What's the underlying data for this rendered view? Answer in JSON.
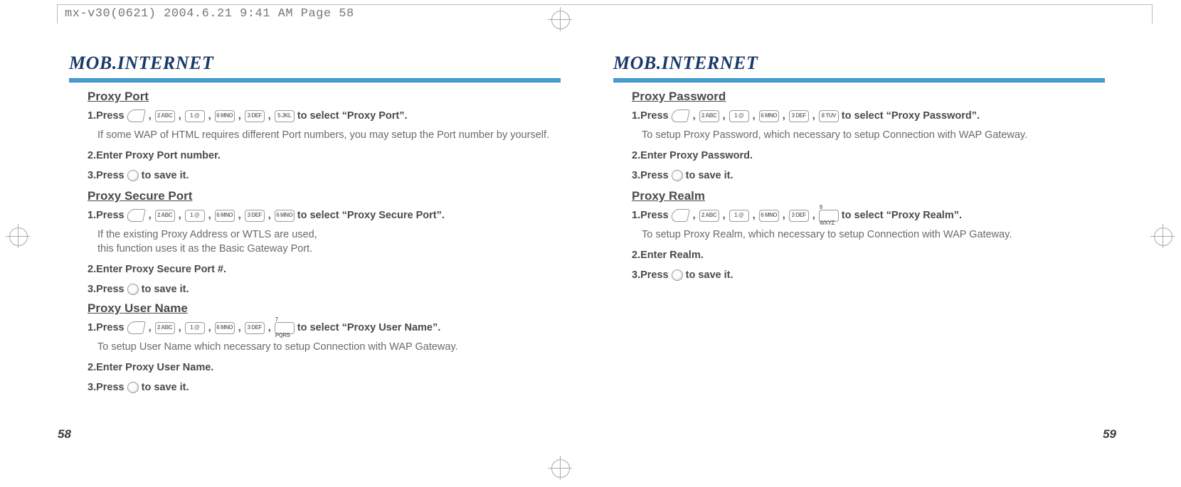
{
  "spine_label": "mx-v30(0621)  2004.6.21  9:41 AM  Page 58",
  "page_left_no": "58",
  "page_right_no": "59",
  "left": {
    "title": "MOB.INTERNET",
    "s1": {
      "head": "Proxy Port",
      "step1_pre": "1.Press",
      "step1_post": "to select “Proxy Port”.",
      "keys": [
        "2 ABC",
        "1 @",
        "6 MNO",
        "3 DEF",
        "5 JKL"
      ],
      "desc": "If some WAP of HTML requires different Port numbers, you may setup the Port number by yourself.",
      "step2": "2.Enter Proxy Port number.",
      "step3_pre": "3.Press",
      "step3_post": "to save it."
    },
    "s2": {
      "head": "Proxy Secure Port",
      "step1_pre": "1.Press",
      "step1_post": "to select “Proxy Secure Port”.",
      "keys": [
        "2 ABC",
        "1 @",
        "6 MNO",
        "3 DEF",
        "6 MNO"
      ],
      "desc1": "If the existing Proxy Address or WTLS are used,",
      "desc2": "this function uses it as the Basic Gateway Port.",
      "step2": "2.Enter Proxy Secure Port #.",
      "step3_pre": "3.Press",
      "step3_post": "to save it."
    },
    "s3": {
      "head": "Proxy User Name",
      "step1_pre": "1.Press",
      "step1_post": "to select “Proxy User Name”.",
      "keys": [
        "2 ABC",
        "1 @",
        "6 MNO",
        "3 DEF",
        "7 PQRS"
      ],
      "desc": "To setup User Name which necessary to setup Connection with WAP Gateway.",
      "step2": "2.Enter Proxy User Name.",
      "step3_pre": "3.Press",
      "step3_post": "to save it."
    }
  },
  "right": {
    "title": "MOB.INTERNET",
    "s1": {
      "head": "Proxy Password",
      "step1_pre": "1.Press",
      "step1_post": "to select “Proxy Password”.",
      "keys": [
        "2 ABC",
        "1 @",
        "6 MNO",
        "3 DEF",
        "8 TUV"
      ],
      "desc": "To setup Proxy Password, which necessary to setup Connection with WAP Gateway.",
      "step2": "2.Enter Proxy Password.",
      "step3_pre": "3.Press",
      "step3_post": "to save it."
    },
    "s2": {
      "head": "Proxy Realm",
      "step1_pre": "1.Press",
      "step1_post": "to select “Proxy Realm”.",
      "keys": [
        "2 ABC",
        "1 @",
        "6 MNO",
        "3 DEF",
        "9 WXYZ"
      ],
      "desc": "To setup Proxy Realm, which necessary to setup Connection with WAP Gateway.",
      "step2": "2.Enter Realm.",
      "step3_pre": "3.Press",
      "step3_post": "to save it."
    }
  }
}
